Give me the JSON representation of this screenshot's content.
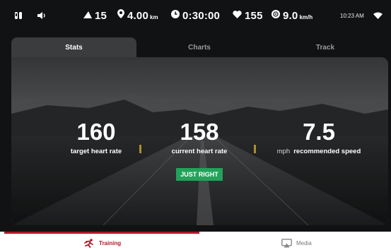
{
  "status_bar": {
    "incline": "15",
    "distance": "4.00",
    "distance_unit": "km",
    "elapsed": "0:30:00",
    "heart_rate": "155",
    "speed": "9.0",
    "speed_unit": "km/h",
    "clock": "10:23 AM"
  },
  "tabs": [
    {
      "label": "Stats",
      "active": true
    },
    {
      "label": "Charts",
      "active": false
    },
    {
      "label": "Track",
      "active": false
    }
  ],
  "metrics": {
    "target": {
      "value": "160",
      "label": "target heart rate"
    },
    "current": {
      "value": "158",
      "label": "current heart rate"
    },
    "speed": {
      "value": "7.5",
      "prefix": "mph",
      "label": "recommended speed"
    }
  },
  "badge": "JUST RIGHT",
  "bottom_nav": [
    {
      "label": "Training",
      "icon": "runner-icon",
      "active": true
    },
    {
      "label": "Media",
      "icon": "airplay-icon",
      "active": false
    }
  ],
  "colors": {
    "accent": "#b3182a",
    "badge_green": "#20a35a",
    "panel": "#3b3c3e",
    "background": "#111213"
  }
}
